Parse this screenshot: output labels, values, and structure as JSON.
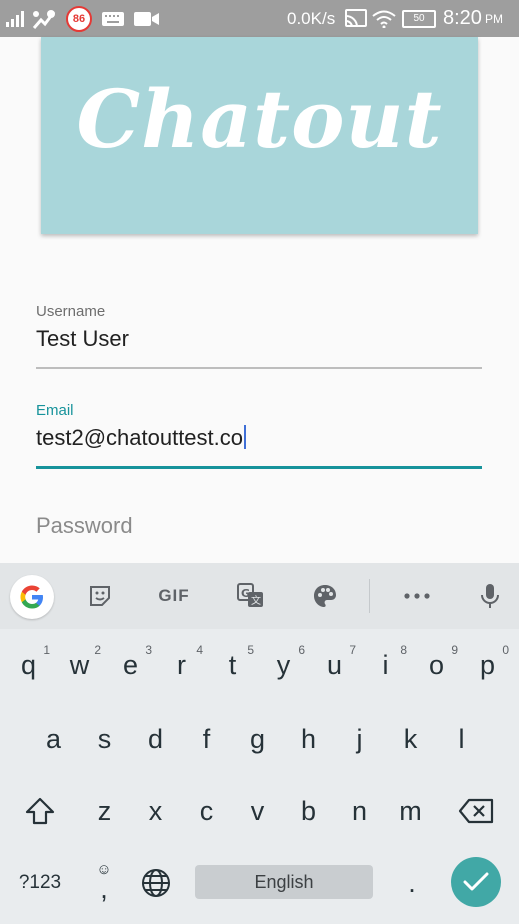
{
  "status_bar": {
    "network_speed": "0.0K/s",
    "time": "8:20",
    "ampm": "PM",
    "notification_count": "86",
    "battery": "50",
    "icons": [
      "signal-icon",
      "usb-debug-icon",
      "notification-badge-icon",
      "keyboard-icon",
      "video-icon",
      "cast-icon",
      "wifi-icon",
      "battery-icon"
    ]
  },
  "logo": {
    "text": "Chatout",
    "background": "#a9d6da"
  },
  "form": {
    "username": {
      "label": "Username",
      "value": "Test User"
    },
    "email": {
      "label": "Email",
      "value": "test2@chatouttest.co"
    },
    "password": {
      "placeholder": "Password"
    }
  },
  "keyboard": {
    "toolbar": [
      "google-icon",
      "sticker-icon",
      "GIF",
      "translate-icon",
      "palette-icon",
      "more-icon",
      "mic-icon"
    ],
    "gif_label": "GIF",
    "row1": [
      {
        "key": "q",
        "hint": "1"
      },
      {
        "key": "w",
        "hint": "2"
      },
      {
        "key": "e",
        "hint": "3"
      },
      {
        "key": "r",
        "hint": "4"
      },
      {
        "key": "t",
        "hint": "5"
      },
      {
        "key": "y",
        "hint": "6"
      },
      {
        "key": "u",
        "hint": "7"
      },
      {
        "key": "i",
        "hint": "8"
      },
      {
        "key": "o",
        "hint": "9"
      },
      {
        "key": "p",
        "hint": "0"
      }
    ],
    "row2": [
      "a",
      "s",
      "d",
      "f",
      "g",
      "h",
      "j",
      "k",
      "l"
    ],
    "row3": [
      "z",
      "x",
      "c",
      "v",
      "b",
      "n",
      "m"
    ],
    "symbols_label": "?123",
    "comma": ",",
    "period": ".",
    "space_label": "English",
    "accent": "#41a8a6"
  }
}
